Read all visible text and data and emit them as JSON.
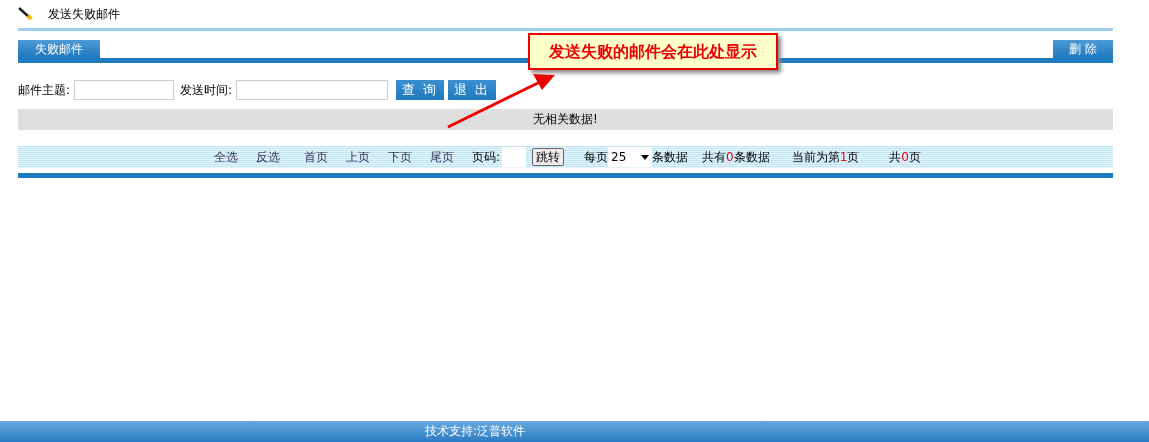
{
  "page_title": "发送失败邮件",
  "tabs": [
    {
      "label": "失败邮件",
      "selected": true
    }
  ],
  "delete_button": "删 除",
  "search": {
    "fields": [
      {
        "label": "邮件主题:"
      },
      {
        "label": "发送时间:"
      }
    ],
    "buttons": [
      "查 询",
      "退 出"
    ]
  },
  "empty_message": "无相关数据!",
  "pager": {
    "links": [
      "全选",
      "反选",
      "首页",
      "上页",
      "下页",
      "尾页"
    ],
    "page_label": "页码:",
    "go_button": "跳转",
    "per_page_label": "每页",
    "per_page": "25",
    "per_page_suffix": "条数据",
    "counts": [
      {
        "prefix": "共有",
        "number": "0",
        "suffix": "条数据"
      },
      {
        "prefix": "当前为第",
        "number": "1",
        "suffix": "页"
      },
      {
        "prefix": "共",
        "number": "0",
        "suffix": "页"
      }
    ]
  },
  "callout": "发送失败的邮件会在此处显示",
  "footer": "技术支持:泛普软件"
}
